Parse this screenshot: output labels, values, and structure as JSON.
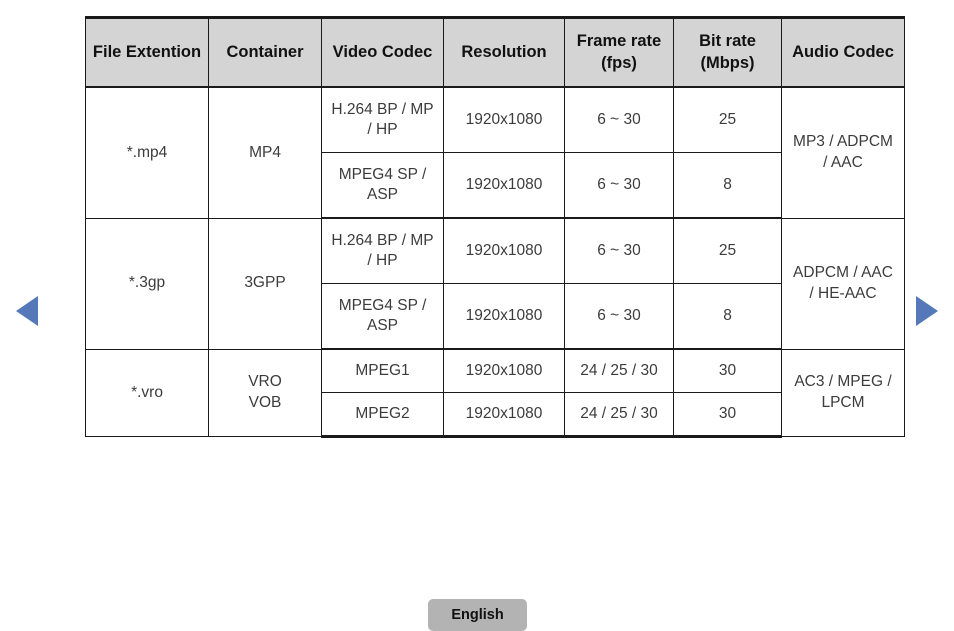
{
  "nav": {
    "prev_icon": "triangle-left-icon",
    "next_icon": "triangle-right-icon",
    "accent_color": "#5578b8"
  },
  "table": {
    "headers": [
      "File Extention",
      "Container",
      "Video Codec",
      "Resolution",
      "Frame rate\n(fps)",
      "Bit rate\n(Mbps)",
      "Audio Codec"
    ],
    "header_lines": {
      "frame_rate_1": "Frame rate",
      "frame_rate_2": "(fps)",
      "bit_rate_1": "Bit rate",
      "bit_rate_2": "(Mbps)"
    },
    "header_bg": "#d4d4d4",
    "groups": [
      {
        "file_extension": "*.mp4",
        "container": "MP4",
        "audio_codec_1": "MP3 / ADPCM",
        "audio_codec_2": "/ AAC",
        "rows": [
          {
            "video_codec_1": "H.264 BP / MP",
            "video_codec_2": "/ HP",
            "resolution": "1920x1080",
            "frame_rate": "6 ~ 30",
            "bit_rate": "25"
          },
          {
            "video_codec_1": "MPEG4 SP /",
            "video_codec_2": "ASP",
            "resolution": "1920x1080",
            "frame_rate": "6 ~ 30",
            "bit_rate": "8"
          }
        ]
      },
      {
        "file_extension": "*.3gp",
        "container": "3GPP",
        "audio_codec_1": "ADPCM / AAC",
        "audio_codec_2": "/ HE-AAC",
        "rows": [
          {
            "video_codec_1": "H.264 BP / MP",
            "video_codec_2": "/ HP",
            "resolution": "1920x1080",
            "frame_rate": "6 ~ 30",
            "bit_rate": "25"
          },
          {
            "video_codec_1": "MPEG4 SP /",
            "video_codec_2": "ASP",
            "resolution": "1920x1080",
            "frame_rate": "6 ~ 30",
            "bit_rate": "8"
          }
        ]
      },
      {
        "file_extension": "*.vro",
        "container_1": "VRO",
        "container_2": "VOB",
        "audio_codec_1": "AC3 / MPEG /",
        "audio_codec_2": "LPCM",
        "rows": [
          {
            "video_codec_1": "MPEG1",
            "video_codec_2": "",
            "resolution": "1920x1080",
            "frame_rate": "24 / 25 / 30",
            "bit_rate": "30"
          },
          {
            "video_codec_1": "MPEG2",
            "video_codec_2": "",
            "resolution": "1920x1080",
            "frame_rate": "24 / 25 / 30",
            "bit_rate": "30"
          }
        ]
      }
    ]
  },
  "footer": {
    "language_label": "English"
  }
}
